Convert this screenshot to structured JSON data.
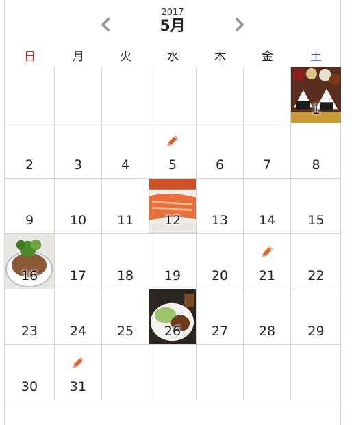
{
  "calendar": {
    "year": "2017",
    "month_label": "5月",
    "weekdays": [
      "日",
      "月",
      "火",
      "水",
      "木",
      "金",
      "土"
    ],
    "days": [
      "",
      "",
      "",
      "",
      "",
      "",
      "1",
      "2",
      "3",
      "4",
      "5",
      "6",
      "7",
      "8",
      "9",
      "10",
      "11",
      "12",
      "13",
      "14",
      "15",
      "16",
      "17",
      "18",
      "19",
      "20",
      "21",
      "22",
      "23",
      "24",
      "25",
      "26",
      "27",
      "28",
      "29",
      "30",
      "31",
      "",
      "",
      "",
      "",
      ""
    ],
    "entries": {
      "pencil_days": [
        "5",
        "21",
        "31"
      ],
      "photo_days": [
        "1",
        "12",
        "16",
        "26"
      ]
    }
  },
  "colors": {
    "sunday": "#d9262c",
    "saturday": "#2a54c4",
    "pencil": "#e0622a",
    "grid_line": "#d6d6d6"
  },
  "icons": {
    "prev": "chevron-left-icon",
    "next": "chevron-right-icon",
    "note": "pencil-icon"
  }
}
